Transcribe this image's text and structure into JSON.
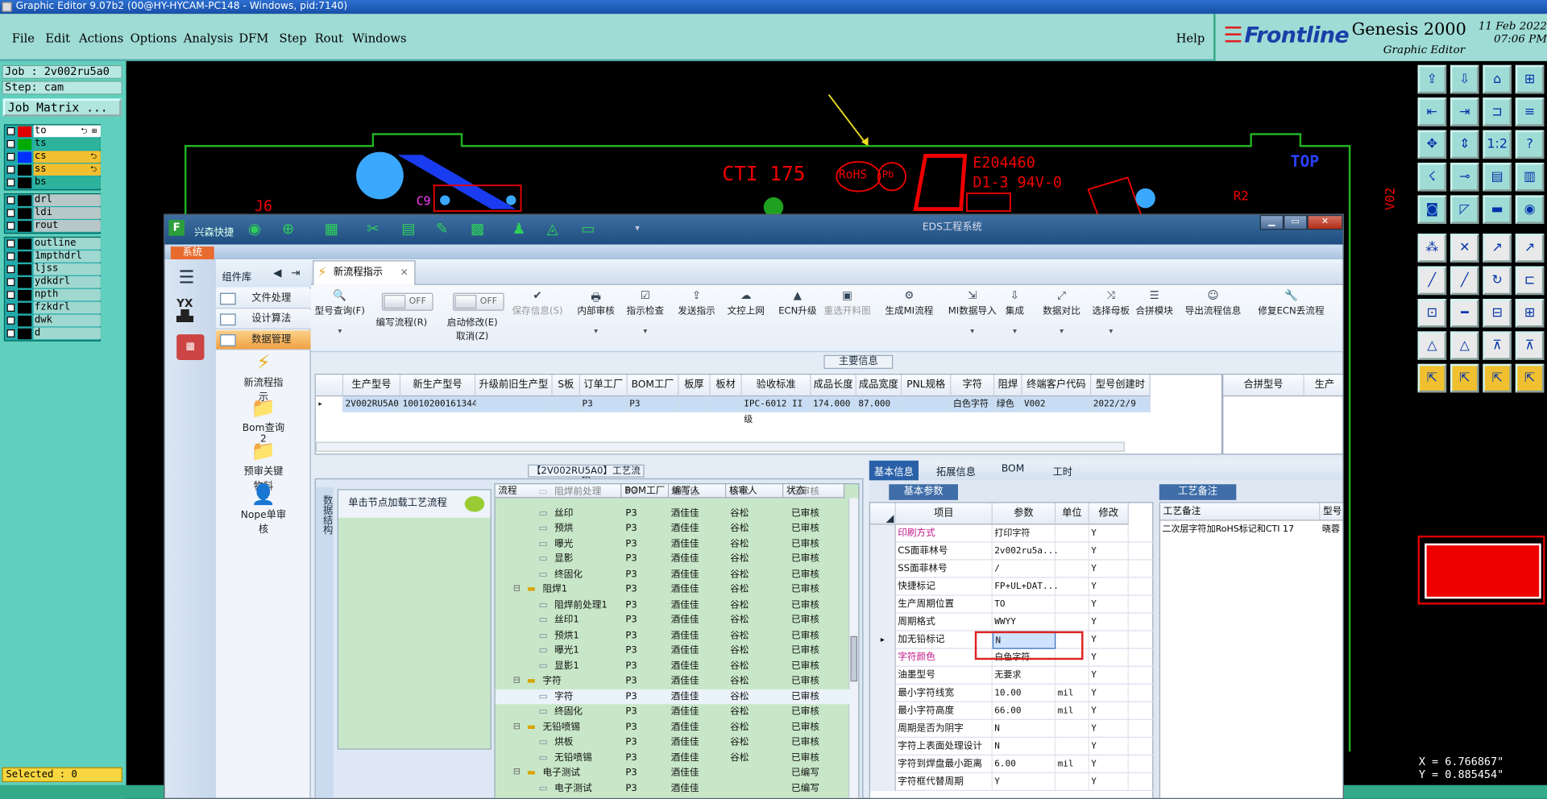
{
  "window": {
    "title": "Graphic Editor 9.07b2 (00@HY-HYCAM-PC148 - Windows, pid:7140)"
  },
  "menu": [
    "File",
    "Edit",
    "Actions",
    "Options",
    "Analysis",
    "DFM",
    "Step",
    "Rout",
    "Windows"
  ],
  "help": "Help",
  "brand": {
    "frontline": "Frontline",
    "genesis": "Genesis 2000",
    "sub": "Graphic Editor",
    "date": "11 Feb 2022",
    "time": "07:06 PM"
  },
  "left": {
    "job": "Job : 2v002ru5a0",
    "step": "Step: cam",
    "job_matrix": "Job Matrix ...",
    "selected": "Selected : 0"
  },
  "layers_board": [
    {
      "name": "to",
      "color": "#e00000",
      "bg": "#ffffff",
      "mark": "⮌ ⊞"
    },
    {
      "name": "ts",
      "color": "#00aa00",
      "bg": "#2db39c",
      "mark": ""
    },
    {
      "name": "cs",
      "color": "#0030ff",
      "bg": "#f0c030",
      "mark": "⮌"
    },
    {
      "name": "ss",
      "color": "#000000",
      "bg": "#f0c030",
      "mark": "⮌"
    },
    {
      "name": "bs",
      "color": "#000000",
      "bg": "#2db39c",
      "mark": ""
    }
  ],
  "layers_drill": [
    {
      "name": "drl"
    },
    {
      "name": "ldi"
    },
    {
      "name": "rout"
    }
  ],
  "layers_misc": [
    {
      "name": "outline"
    },
    {
      "name": "1mpthdrl"
    },
    {
      "name": "ljss"
    },
    {
      "name": "ydkdrl"
    },
    {
      "name": "npth"
    },
    {
      "name": "fzkdrl"
    },
    {
      "name": "dwk"
    },
    {
      "name": "d"
    }
  ],
  "pcb": {
    "j6": "J6",
    "c9": "C9",
    "cti": "CTI 175",
    "rohs": "RoHS",
    "pb": "Pb",
    "e": "E204460",
    "d13": "D1-3 94V-0",
    "top": "TOP",
    "r2": "R2",
    "v02": "V02"
  },
  "coords": {
    "x": "X = 6.766867\"",
    "y": "Y = 0.885454\""
  },
  "eds": {
    "app": "兴森快捷",
    "title": "EDS工程系统",
    "sys": "系统",
    "comp_lib": "组件库",
    "comp_items": [
      "文件处理",
      "设计算法",
      "数据管理"
    ],
    "big_icons": [
      "新流程指示",
      "Bom查询2",
      "预审关键物料",
      "Nope单审核"
    ],
    "tab": "新流程指示",
    "toggle_off": "OFF",
    "ribbon": [
      {
        "label": "型号查询(F)",
        "icon": "🔍"
      },
      {
        "label": "编写流程(R)",
        "icon": ""
      },
      {
        "label": "启动修改(E)",
        "sub": "取消(Z)",
        "icon": ""
      },
      {
        "label": "保存信息(S)",
        "icon": "✔"
      },
      {
        "label": "内部审核",
        "icon": "🖶"
      },
      {
        "label": "指示检查",
        "icon": "☑"
      },
      {
        "label": "发送指示",
        "icon": "⇪"
      },
      {
        "label": "文控上网",
        "icon": "☁"
      },
      {
        "label": "ECN升级",
        "icon": "▲"
      },
      {
        "label": "重选开料图",
        "icon": "▣"
      },
      {
        "label": "生成MI流程",
        "icon": "⚙"
      },
      {
        "label": "MI数据导入",
        "icon": "⇲"
      },
      {
        "label": "集成",
        "icon": "⇩"
      },
      {
        "label": "数据对比",
        "icon": "⤢"
      },
      {
        "label": "选择母板",
        "icon": "⤨"
      },
      {
        "label": "合拼模块",
        "icon": "☰"
      },
      {
        "label": "导出流程信息",
        "icon": "☺"
      },
      {
        "label": "修复ECN丢流程",
        "icon": "🔧"
      }
    ],
    "main_info": "主要信息",
    "grid1_headers": [
      "生产型号",
      "新生产型号",
      "升级前旧生产型号",
      "S板",
      "订单工厂",
      "BOM工厂",
      "板厚",
      "板材",
      "验收标准",
      "成品长度",
      "成品宽度",
      "PNL规格",
      "字符",
      "阻焊",
      "终端客户代码",
      "型号创建时"
    ],
    "grid1_row": [
      "2V002RU5A0",
      "10010200161344",
      "",
      "",
      "P3",
      "P3",
      "",
      "",
      "IPC-6012 II级",
      "174.000",
      "87.000",
      "",
      "白色字符",
      "绿色",
      "V002",
      "2022/2/9"
    ],
    "grid1b_headers": [
      "合拼型号",
      "生产"
    ],
    "flow_label": "【2V002RU5A0】工艺流程",
    "flow_side": "数据结构",
    "flow_hint": "单击节点加载工艺流程",
    "tree_headers": [
      "流程",
      "BOM工厂",
      "编写人",
      "核审人",
      "状态"
    ],
    "tree": [
      {
        "name": "阻焊前处理",
        "lvl": 2,
        "f": "P3",
        "w": "酒佳佳",
        "r": "谷松",
        "s": "已审核"
      },
      {
        "name": "丝印",
        "lvl": 2,
        "f": "P3",
        "w": "酒佳佳",
        "r": "谷松",
        "s": "已审核"
      },
      {
        "name": "预烘",
        "lvl": 2,
        "f": "P3",
        "w": "酒佳佳",
        "r": "谷松",
        "s": "已审核"
      },
      {
        "name": "曝光",
        "lvl": 2,
        "f": "P3",
        "w": "酒佳佳",
        "r": "谷松",
        "s": "已审核"
      },
      {
        "name": "显影",
        "lvl": 2,
        "f": "P3",
        "w": "酒佳佳",
        "r": "谷松",
        "s": "已审核"
      },
      {
        "name": "终固化",
        "lvl": 2,
        "f": "P3",
        "w": "酒佳佳",
        "r": "谷松",
        "s": "已审核"
      },
      {
        "name": "阻焊1",
        "lvl": 1,
        "f": "P3",
        "w": "酒佳佳",
        "r": "谷松",
        "s": "已审核"
      },
      {
        "name": "阻焊前处理1",
        "lvl": 2,
        "f": "P3",
        "w": "酒佳佳",
        "r": "谷松",
        "s": "已审核"
      },
      {
        "name": "丝印1",
        "lvl": 2,
        "f": "P3",
        "w": "酒佳佳",
        "r": "谷松",
        "s": "已审核"
      },
      {
        "name": "预烘1",
        "lvl": 2,
        "f": "P3",
        "w": "酒佳佳",
        "r": "谷松",
        "s": "已审核"
      },
      {
        "name": "曝光1",
        "lvl": 2,
        "f": "P3",
        "w": "酒佳佳",
        "r": "谷松",
        "s": "已审核"
      },
      {
        "name": "显影1",
        "lvl": 2,
        "f": "P3",
        "w": "酒佳佳",
        "r": "谷松",
        "s": "已审核"
      },
      {
        "name": "字符",
        "lvl": 1,
        "f": "P3",
        "w": "酒佳佳",
        "r": "谷松",
        "s": "已审核"
      },
      {
        "name": "字符",
        "lvl": 2,
        "f": "P3",
        "w": "酒佳佳",
        "r": "谷松",
        "s": "已审核",
        "sel": true
      },
      {
        "name": "终固化",
        "lvl": 2,
        "f": "P3",
        "w": "酒佳佳",
        "r": "谷松",
        "s": "已审核"
      },
      {
        "name": "无铅喷锡",
        "lvl": 1,
        "f": "P3",
        "w": "酒佳佳",
        "r": "谷松",
        "s": "已审核"
      },
      {
        "name": "烘板",
        "lvl": 2,
        "f": "P3",
        "w": "酒佳佳",
        "r": "谷松",
        "s": "已审核"
      },
      {
        "name": "无铅喷锡",
        "lvl": 2,
        "f": "P3",
        "w": "酒佳佳",
        "r": "谷松",
        "s": "已审核"
      },
      {
        "name": "电子测试",
        "lvl": 1,
        "f": "P3",
        "w": "酒佳佳",
        "r": "",
        "s": "已编写"
      },
      {
        "name": "电子测试",
        "lvl": 2,
        "f": "P3",
        "w": "酒佳佳",
        "r": "",
        "s": "已编写"
      }
    ],
    "rp_tabs": [
      "基本信息",
      "拓展信息",
      "BOM",
      "工时"
    ],
    "basic_params": "基本参数",
    "param_headers": [
      "项目",
      "参数",
      "单位",
      "修改"
    ],
    "params": [
      {
        "item": "印刷方式",
        "val": "打印字符",
        "unit": "",
        "mod": "Y",
        "pink": true
      },
      {
        "item": "CS面菲林号",
        "val": "2v002ru5a...",
        "unit": "",
        "mod": "Y"
      },
      {
        "item": "SS面菲林号",
        "val": "/",
        "unit": "",
        "mod": "Y"
      },
      {
        "item": "快捷标记",
        "val": "FP+UL+DAT...",
        "unit": "",
        "mod": "Y"
      },
      {
        "item": "生产周期位置",
        "val": "TO",
        "unit": "",
        "mod": "Y"
      },
      {
        "item": "周期格式",
        "val": "WWYY",
        "unit": "",
        "mod": "Y"
      },
      {
        "item": "加无铅标记",
        "val": "N",
        "unit": "",
        "mod": "Y",
        "cur": true
      },
      {
        "item": "字符颜色",
        "val": "白色字符",
        "unit": "",
        "mod": "Y",
        "pink": true
      },
      {
        "item": "油墨型号",
        "val": "无要求",
        "unit": "",
        "mod": "Y"
      },
      {
        "item": "最小字符线宽",
        "val": "10.00",
        "unit": "mil",
        "mod": "Y"
      },
      {
        "item": "最小字符高度",
        "val": "66.00",
        "unit": "mil",
        "mod": "Y"
      },
      {
        "item": "周期是否为阴字",
        "val": "N",
        "unit": "",
        "mod": "Y"
      },
      {
        "item": "字符上表面处理设计",
        "val": "N",
        "unit": "",
        "mod": "Y"
      },
      {
        "item": "字符到焊盘最小距离",
        "val": "6.00",
        "unit": "mil",
        "mod": "Y"
      },
      {
        "item": "字符框代替周期",
        "val": "Y",
        "unit": "",
        "mod": "Y"
      }
    ],
    "remark": "工艺备注",
    "remark_headers": [
      "工艺备注",
      "型号"
    ],
    "remark_row": [
      "二次层字符加RoHS标记和CTI 17",
      "晓蓉"
    ]
  }
}
